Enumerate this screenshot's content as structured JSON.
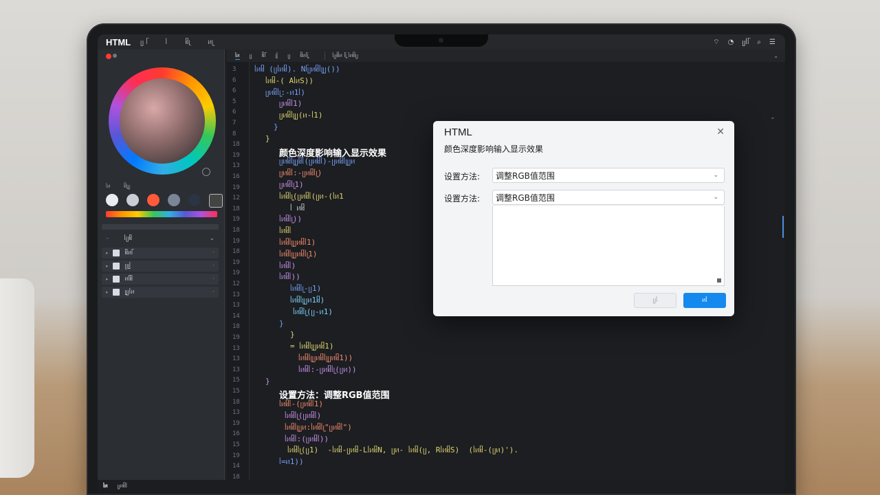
{
  "menubar": {
    "brand": "HTML",
    "items": [
      "ᥩ ᥬ",
      "ᥣ",
      "ᥤᥨ",
      "ᥢᥧ"
    ],
    "status": [
      "⌔",
      "◔",
      "ᥩᥣᥬ",
      "⌕",
      "☰"
    ]
  },
  "left_panel": {
    "swatch_labels": [
      "ᥣᥢ",
      "ᥤᥧᥩ"
    ],
    "swatch_colors": [
      "#e9ecf0",
      "#c9ced6",
      "#ff5a3c",
      "#7a8598",
      "#2b3442"
    ],
    "layers_title": "ᥣᥩᥤ",
    "layers": [
      "ᥤᥢᥬ",
      "ᥩᥧᥣ",
      "ᥢᥬᥤ",
      "ᥧᥩᥣᥢ"
    ]
  },
  "tabs": [
    "ᥣᥢ",
    "ᥩ",
    "ᥤᥬ",
    "ᥧᥣ",
    "ᥩ",
    "ᥤᥢᥬᥧ",
    "ᥣᥩᥤᥢ ᥬᥧ ᥣᥢᥤᥩ"
  ],
  "editor": {
    "line_numbers": [
      "3",
      "6",
      "6",
      "5",
      "6",
      "7",
      "8",
      "18",
      "19",
      "13",
      "16",
      "19",
      "12",
      "18",
      "19",
      "18",
      "19",
      "18",
      "19",
      "19",
      "12",
      "13",
      "13",
      "14",
      "18",
      "19",
      "13",
      "13",
      "13",
      "15",
      "15",
      "18",
      "13",
      "19",
      "16",
      "15",
      "19",
      "14",
      "18",
      "19",
      "19",
      "18"
    ],
    "heading_1": "颜色深度影响输入显示效果",
    "heading_2": "设置方法：调整RGB值范围",
    "code_lines": [
      {
        "text": "ᥣᥢᥤ (ᥩᥣᥢᥤ). Nᥬᥩᥢᥤᥣᥧᥩ())",
        "color": "#7aa2f7"
      },
      {
        "text": "ᥣᥢᥤ-( AᥣᥢS))",
        "color": "#e0d56e"
      },
      {
        "text": "ᥩᥢᥤᥣᥧ:-ᥢ1ᥣ)",
        "color": "#7aa2f7"
      },
      {
        "text": "ᥩᥢᥤᥣ1)",
        "color": "#c792ea"
      },
      {
        "text": "ᥩᥢᥤᥣᥧᥩ(ᥢ-ᥣ1)",
        "color": "#e0d56e"
      },
      {
        "text": "}",
        "color": "#7aa2f7"
      },
      {
        "text": "}",
        "color": "#e0d56e"
      },
      {
        "text": "颜色深度影响输入显示效果",
        "color": "#7dd3fc"
      },
      {
        "text": "ᥩᥢᥤᥣᥧᥩᥤᥣ(ᥩᥢᥤᥣ)-ᥩᥢᥤᥣᥧᥩᥢ",
        "color": "#7aa2f7"
      },
      {
        "text": "ᥩᥢᥤᥣ:-ᥩᥢᥤᥣᥧ)",
        "color": "#f78c6c"
      },
      {
        "text": "ᥩᥢᥤᥣᥧ1)",
        "color": "#c792ea"
      },
      {
        "text": "ᥣᥢᥤᥣᥧ(ᥩᥢᥤᥣ(ᥩᥢ-(ᥣᥢ1",
        "color": "#e0d56e"
      },
      {
        "text": "ᥣ ᥢᥤ",
        "color": "#cfd3da"
      },
      {
        "text": "ᥣᥢᥤᥣᥧ))",
        "color": "#c792ea"
      },
      {
        "text": "ᥣᥢᥤᥣ",
        "color": "#e0d56e"
      },
      {
        "text": "ᥣᥢᥤᥣᥧᥩᥢᥤᥣ1)",
        "color": "#f78c6c"
      },
      {
        "text": "ᥣᥢᥤᥣᥧᥩᥢᥤᥣᥧ1)",
        "color": "#f78c6c"
      },
      {
        "text": "ᥣᥢᥤᥣ)",
        "color": "#c792ea"
      },
      {
        "text": "ᥣᥢᥤᥣ))",
        "color": "#c792ea"
      },
      {
        "text": "ᥣᥢᥤᥣᥧ-ᥩ1)",
        "color": "#7aa2f7"
      },
      {
        "text": "ᥣᥢᥤᥣᥧᥩᥢ1ᥤ)",
        "color": "#7dd3fc"
      },
      {
        "text": "ᥣᥢᥤᥣᥧ(ᥩ-ᥢ1)",
        "color": "#7dd3fc"
      },
      {
        "text": "}",
        "color": "#7aa2f7"
      },
      {
        "text": "}",
        "color": "#e0d56e"
      },
      {
        "text": "= ᥣᥢᥤᥣᥧᥩᥢᥤ1)",
        "color": "#e0d56e"
      },
      {
        "text": "ᥣᥢᥤᥣᥧᥩᥢᥤᥣᥧᥩᥢᥤ1))",
        "color": "#f78c6c"
      },
      {
        "text": "ᥣᥢᥤᥣ:-ᥩᥢᥤᥣᥧ(ᥩᥢ))",
        "color": "#c792ea"
      },
      {
        "text": "}",
        "color": "#c792ea"
      },
      {
        "text": "设置方法：调整RGB值范围",
        "color": "#ffffff"
      },
      {
        "text": "ᥣᥢᥤᥣ-(ᥩᥢᥤᥣ1)",
        "color": "#f78c6c"
      },
      {
        "text": "ᥣᥢᥤᥣᥧ(ᥩᥢᥤᥣ)",
        "color": "#c792ea"
      },
      {
        "text": "ᥣᥢᥤᥣᥧᥩᥢ:ᥣᥢᥤᥣᥧ\"ᥩᥢᥤᥣ\")",
        "color": "#f78c6c"
      },
      {
        "text": "ᥣᥢᥤᥣ:(ᥩᥢᥤᥣ))",
        "color": "#c792ea"
      },
      {
        "text": "ᥣᥢᥤᥣᥧ(ᥩ1)  -ᥣᥢᥤ-ᥩᥢᥤ-LᥣᥢᥤN, ᥩᥢ- ᥣᥢᥤ(ᥩ, RᥣᥢᥤS)  (ᥣᥢᥤ-(ᥩᥢ)').",
        "color": "#e0d56e"
      },
      {
        "text": "ᥣ=ᥢ1))",
        "color": "#7aa2f7"
      }
    ]
  },
  "dialog": {
    "title": "HTML",
    "subtitle": "颜色深度影响输入显示效果",
    "field1_label": "设置方法:",
    "field1_value": "调整RGB值范围",
    "field2_label": "设置方法:",
    "field2_value": "调整RGB值范围",
    "cancel_label": "ᥩᥣ",
    "ok_label": "ᥢᥣ"
  },
  "statusbar": {
    "left": "ᥣᥢ",
    "right": "ᥩᥢᥤᥣ"
  }
}
